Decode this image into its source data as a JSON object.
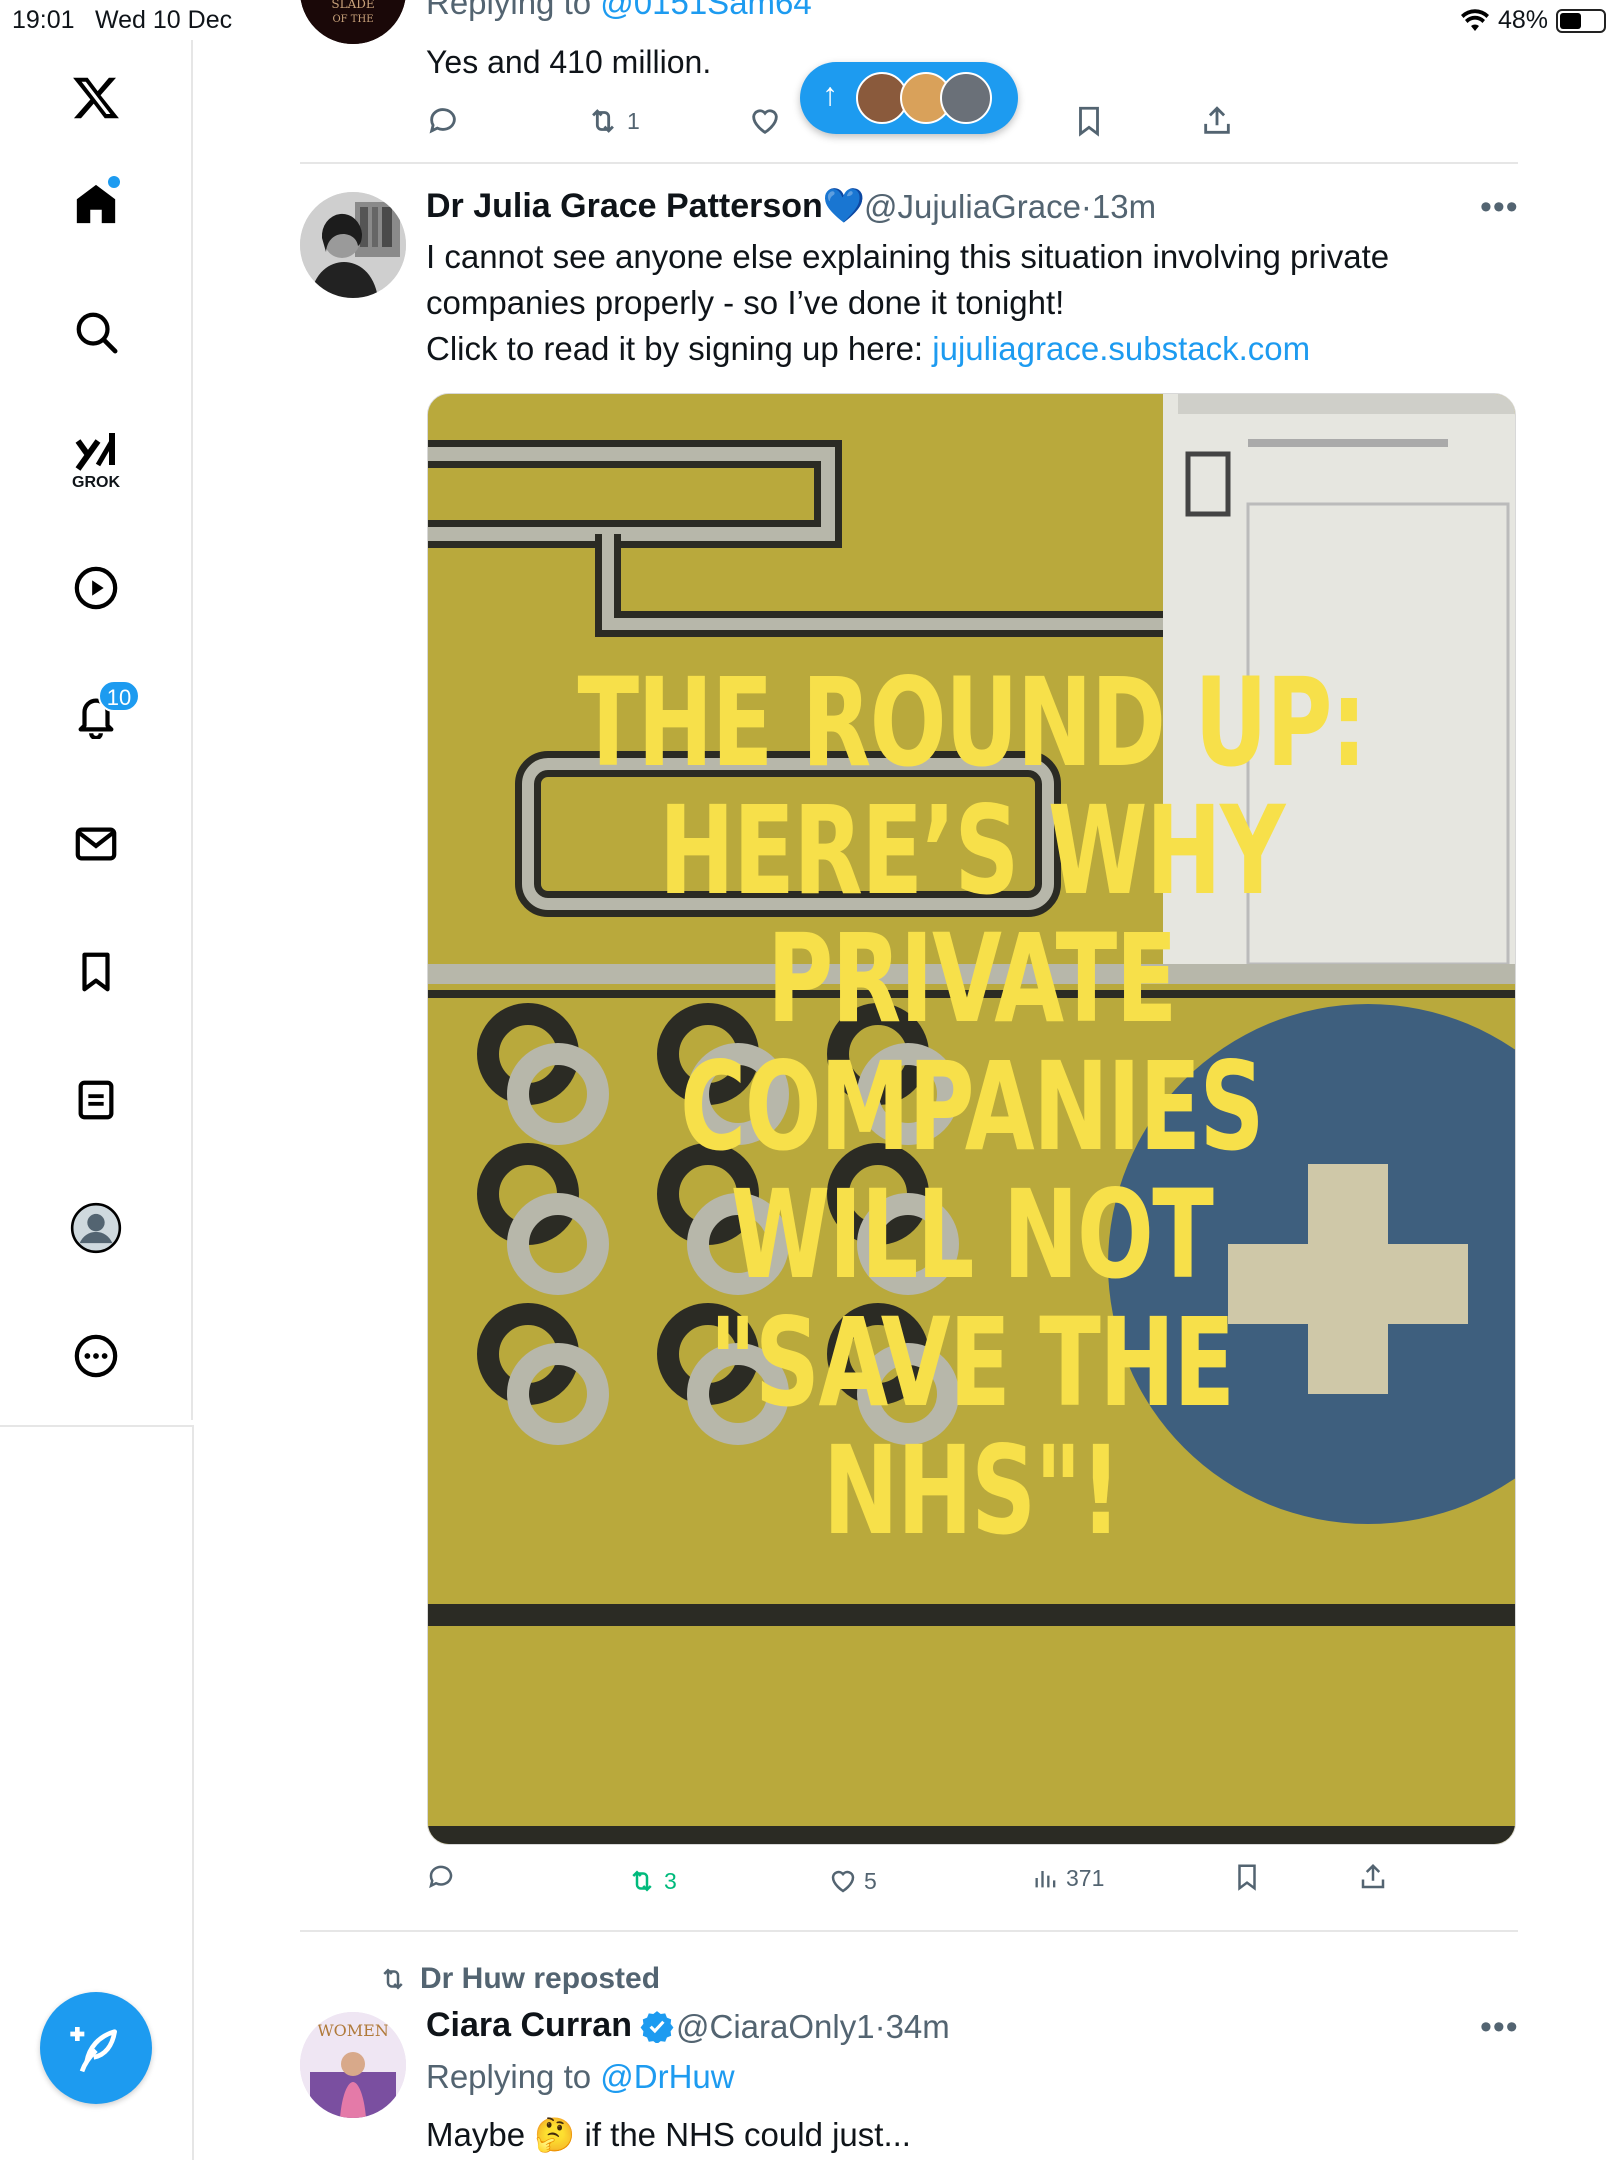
{
  "status_bar": {
    "time": "19:01",
    "date": "Wed 10 Dec",
    "battery": "48%",
    "battery_level": 0.48
  },
  "sidebar": {
    "grok_label": "GROK",
    "notifications_badge": "10"
  },
  "pill": {
    "arrow": "↑"
  },
  "tweet_top": {
    "replying_prefix": "Replying to ",
    "replying_handle": "@0151Sam64",
    "text": "Yes and 410 million.",
    "retweets": "1"
  },
  "tweet_main": {
    "name": "Dr Julia Grace Patterson",
    "heart_emoji": "💙",
    "handle": "@JujuliaGrace",
    "sep": "·",
    "time": "13m",
    "line1": "I cannot see anyone else explaining this situation involving private",
    "line2": "companies properly - so I’ve done it tonight!",
    "line3_prefix": "Click to read it by signing up here: ",
    "line3_link": "jujuliagrace.substack.com",
    "media_headline": "THE ROUND UP: HERE’S WHY PRIVATE COMPANIES WILL NOT \"SAVE THE NHS\"!",
    "retweets": "3",
    "likes": "5",
    "views": "371",
    "retweet_color": "#00ba7c"
  },
  "tweet_bottom": {
    "repost_label": "Dr Huw reposted",
    "name": "Ciara Curran",
    "handle": "@CiaraOnly1",
    "sep": "·",
    "time": "34m",
    "replying_prefix": "Replying to ",
    "replying_handle": "@DrHuw",
    "text_before": "Maybe ",
    "emoji": "🤔",
    "text_after": " if the NHS could just..."
  },
  "colors": {
    "accent": "#1d9bf0",
    "text": "#0f1419",
    "muted": "#536471"
  }
}
